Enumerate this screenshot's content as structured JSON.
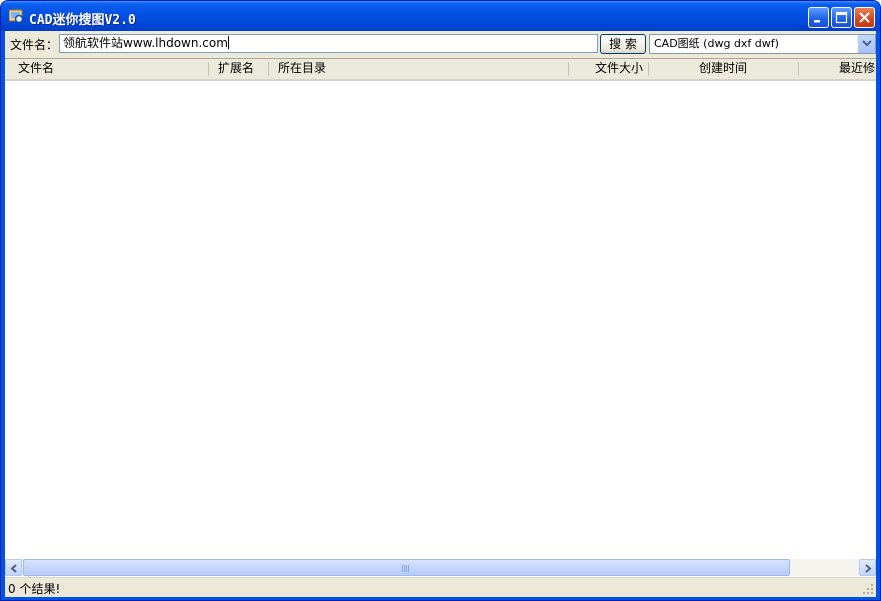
{
  "window": {
    "title": "CAD迷你搜图V2.0",
    "title_bar_color": "#0054e3",
    "close_button_color": "#d4451c",
    "buttons": [
      "minimize-icon",
      "maximize-icon",
      "close-icon"
    ]
  },
  "toolbar": {
    "filename_label": "文件名：",
    "filename_value": "领航软件站www.lhdown.com",
    "search_button_label": "搜 索",
    "file_type_selected": "CAD图纸 (dwg dxf dwf)"
  },
  "list": {
    "columns": [
      "文件名",
      "扩展名",
      "所在目录",
      "文件大小",
      "创建时间",
      "最近修"
    ],
    "rows": []
  },
  "status": {
    "text": "0 个结果!"
  }
}
